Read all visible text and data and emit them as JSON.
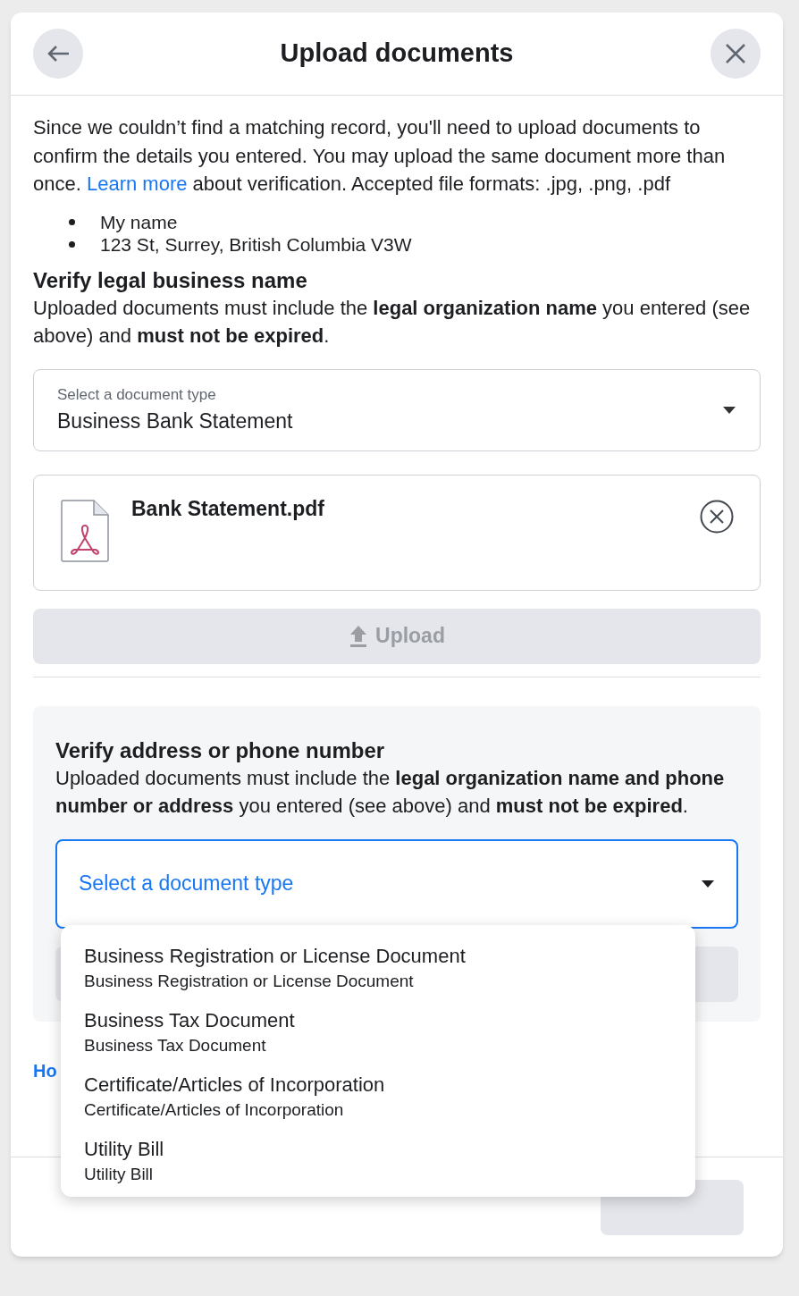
{
  "header": {
    "title": "Upload documents"
  },
  "intro": {
    "before": "Since we couldn’t find a matching record, you'll need to upload documents to confirm the details you entered. You may upload the same document more than once.",
    "link": "Learn more",
    "after": "about verification. Accepted file formats: .jpg, .png, .pdf"
  },
  "details": [
    "My name",
    "123 St, Surrey, British Columbia V3W"
  ],
  "sections": [
    {
      "title": "Verify legal business name",
      "description": "Uploaded documents must include the **legal organization name** you entered (see above) and **must not be expired**.",
      "select": {
        "label": "Select a document type",
        "value": "Business Bank Statement",
        "focused": false,
        "expanded": false
      },
      "files": [
        {
          "name": "Bank Statement.pdf"
        }
      ],
      "upload": {
        "label": "Upload",
        "disabled": true
      },
      "highlighted": false
    },
    {
      "title": "Verify address or phone number",
      "description": "Uploaded documents must include the **legal organization name and phone number or address** you entered (see above) and **must not be expired**.",
      "select": {
        "placeholder": "Select a document type",
        "focused": true,
        "expanded": true,
        "options": [
          {
            "label": "Business Registration or License Document",
            "description": "Business Registration or License Document"
          },
          {
            "label": "Business Tax Document",
            "description": "Business Tax Document"
          },
          {
            "label": "Certificate/Articles of Incorporation",
            "description": "Certificate/Articles of Incorporation"
          },
          {
            "label": "Utility Bill",
            "description": "Utility Bill"
          }
        ]
      },
      "upload": {
        "disabled": true
      },
      "highlighted": true
    }
  ],
  "help_link": "Ho"
}
